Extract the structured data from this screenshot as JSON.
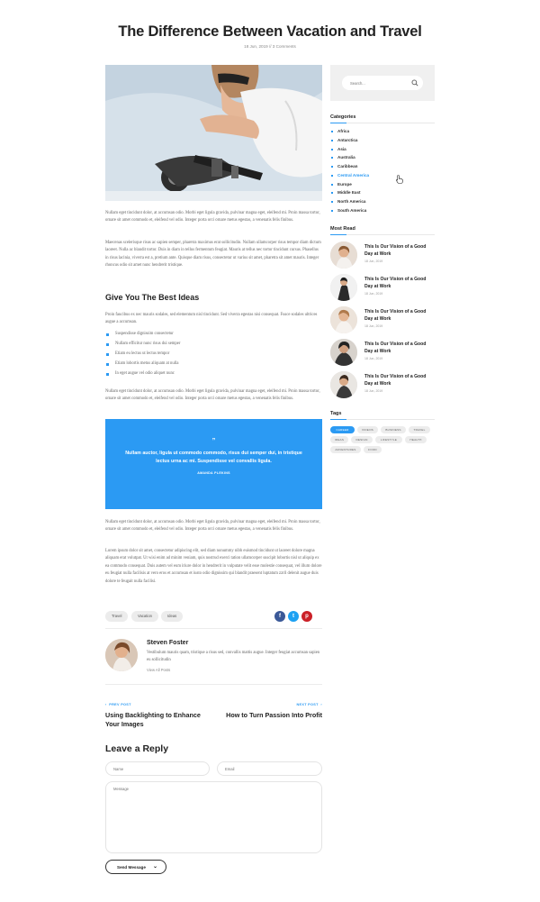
{
  "post": {
    "title": "The Difference Between Vacation and Travel",
    "meta": "18 Jun, 2019  //  3 Comments"
  },
  "content": {
    "para1": "Nullam eget tincidunt dolor, at accumsan odio. Morbi eget ligula gravida, pulvinar magna eget, eleifend mi. Proin massa tortor, ornare sit amet commodo et, eleifend vel odio. Integer porta orci ornare metus egestas, a venenatis felis finibus.",
    "para2": "Maecenas scelerisque risus ac sapien semper, pharetra maximus erat sollicitudin. Nullam ullamcorper risus tempor diam dictum laoreet. Nulla ac blandit tortor. Duis in diam in tellus fermentum feugiat. Mauris at tellus nec tortor tincidunt cursus. Phasellus in risus lacinia, viverra est a, pretium ante. Quisque diam risus, consectetur ut varius sit amet, pharetra sit amet mauris. Integer rhoncus odio sit amet nunc hendrerit tristique.",
    "heading": "Give You The Best Ideas",
    "para3": "Proin faucibus ex nec mauris sodales, sed elementum nisl tincidunt. Sed viverra egestas nisi consequat. Fusce sodales ultrices augue a accumsan.",
    "bullets": [
      "Suspendisse dignissim consectetur",
      "Nullam efficitur nunc risus dui semper",
      "Etiam eu lectus ut lectus tempor",
      "Etiam lobortis metus aliquam at nulla",
      "In eget augue vel odio aliquet nunc"
    ],
    "para4": "Nullam eget tincidunt dolor, at accumsan odio. Morbi eget ligula gravida, pulvinar magna eget, eleifend mi. Proin massa tortor, ornare sit amet commodo et, eleifend vel odio. Integer porta orci ornare metus egestas, a venenatis felis finibus.",
    "quote": {
      "mark": "”",
      "text": "Nullam auctor, ligula ut commodo commodo, risus dui semper dui, in tristique lectus urna ac mi. Suspendisse vel convallis ligula.",
      "author": "AMANDA PLEKINS"
    },
    "para5": "Nullam eget tincidunt dolor, at accumsan odio. Morbi eget ligula gravida, pulvinar magna eget, eleifend mi. Proin massa tortor, ornare sit amet commodo et, eleifend vel odio. Integer porta orci ornare metus egestas, a venenatis felis finibus.",
    "para6": "Lorem ipsum dolor sit amet, consectetur adipiscing elit, sed diam nonummy nibh euismod tincidunt ut laoreet dolore magna aliquam erat volutpat. Ut wisi enim ad minim veniam, quis nostrud exerci tation ullamcorper suscipit lobortis nisl ut aliquip ex ea commodo consequat. Duis autem vel eum iriure dolor in hendrerit in vulputate velit esse molestie consequat, vel illum dolore eu feugiat nulla facilisis at vero eros et accumsan et iusto odio dignissim qui blandit praesent luptatum zzril delenit augue duis dolore te feugait nulla facilisi."
  },
  "post_tags": [
    "Travel",
    "Vacation",
    "Ideas"
  ],
  "share": {
    "facebook": "f",
    "twitter": "t",
    "pinterest": "p",
    "colors": {
      "facebook": "#3b5998",
      "twitter": "#1da1f2",
      "pinterest": "#cb2027"
    }
  },
  "author": {
    "name": "Steven Foster",
    "bio": "Vestibulum mauris quam, tristique a risus sed, convallis mattis augue. Integer feugiat accumsan sapien eu sollicitudin",
    "link": "View All Posts"
  },
  "post_nav": {
    "prev_label": "PREV POST",
    "prev_title": "Using Backlighting to Enhance Your Images",
    "next_label": "NEXT POST",
    "next_title": "How to Turn Passion Into Profit"
  },
  "reply": {
    "heading": "Leave a Reply",
    "name_placeholder": "Name",
    "email_placeholder": "Email",
    "message_placeholder": "Message",
    "send_label": "Send Message"
  },
  "sidebar": {
    "search_placeholder": "Search...",
    "categories_title": "Categories",
    "categories": [
      "Africa",
      "Antarctica",
      "Asia",
      "Australia",
      "Caribbean",
      "Central America",
      "Europe",
      "Middle East",
      "North America",
      "South America"
    ],
    "active_category": "Central America",
    "most_read_title": "Most Read",
    "most_read": [
      {
        "title": "This Is Our Vision of a Good Day at Work",
        "date": "18 Jun, 2019"
      },
      {
        "title": "This Is Our Vision of a Good Day at Work",
        "date": "18 Jun, 2019"
      },
      {
        "title": "This Is Our Vision of a Good Day at Work",
        "date": "18 Jun, 2019"
      },
      {
        "title": "This Is Our Vision of a Good Day at Work",
        "date": "18 Jun, 2019"
      },
      {
        "title": "This Is Our Vision of a Good Day at Work",
        "date": "18 Jun, 2019"
      }
    ],
    "tags_title": "Tags",
    "tags": [
      "CAREER",
      "VIDEOS",
      "BUSINESS",
      "TRAVEL",
      "IDEAS",
      "DESIGN",
      "LIFESTYLE",
      "HEALTH",
      "ADVENTURES",
      "FOOD"
    ],
    "active_tag": "CAREER"
  },
  "colors": {
    "accent": "#2b9af3",
    "heading": "#222222",
    "body_text": "#666666"
  }
}
